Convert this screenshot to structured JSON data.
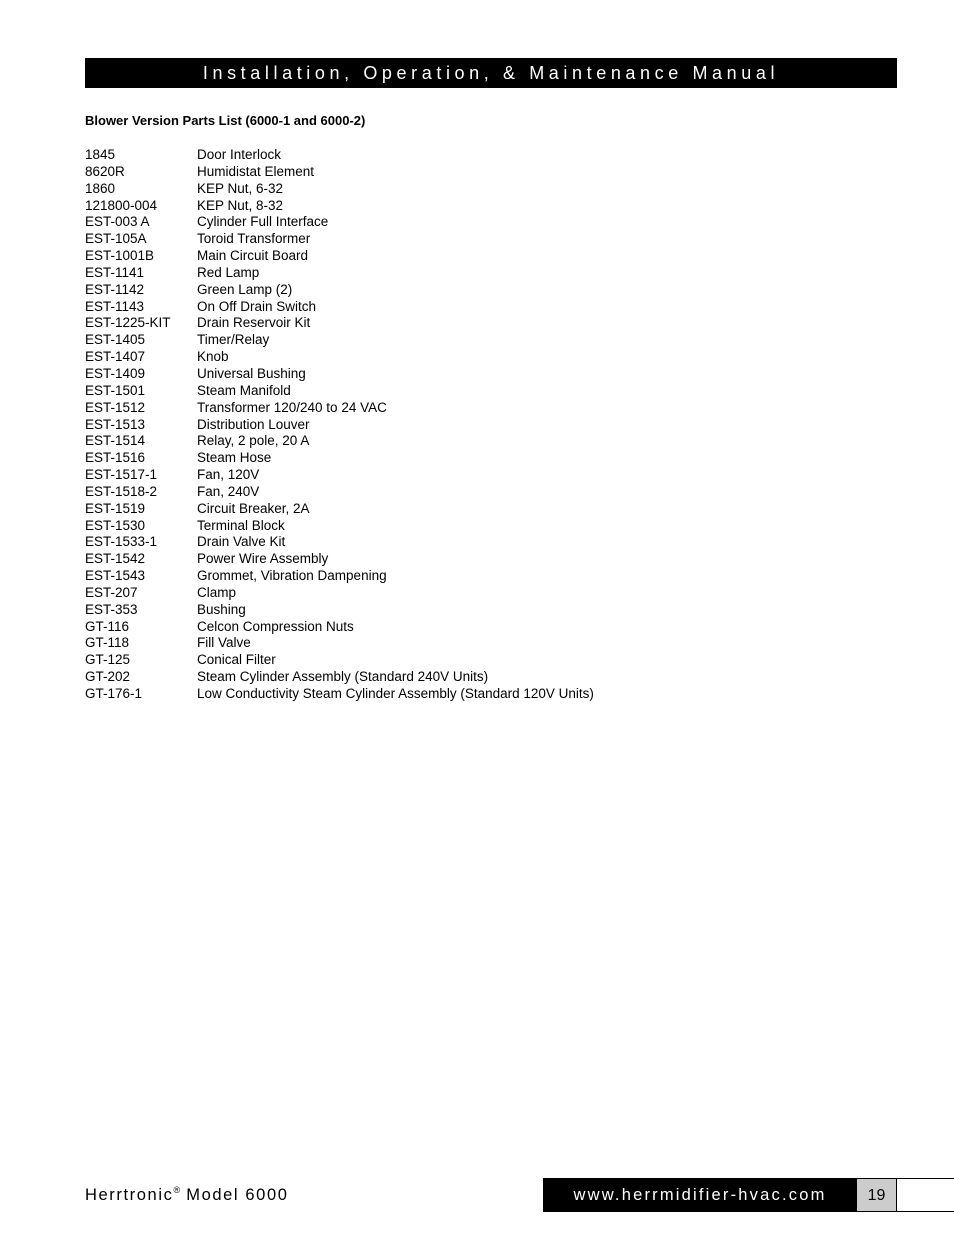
{
  "header": {
    "title": "Installation, Operation, & Maintenance Manual"
  },
  "section": {
    "title": "Blower Version Parts List (6000-1 and 6000-2)"
  },
  "parts": [
    {
      "number": "1845",
      "description": "Door Interlock"
    },
    {
      "number": "8620R",
      "description": "Humidistat Element"
    },
    {
      "number": "1860",
      "description": "KEP Nut, 6-32"
    },
    {
      "number": "121800-004",
      "description": "KEP Nut, 8-32"
    },
    {
      "number": "EST-003 A",
      "description": "Cylinder Full Interface"
    },
    {
      "number": "EST-105A",
      "description": "Toroid Transformer"
    },
    {
      "number": "EST-1001B",
      "description": "Main Circuit Board"
    },
    {
      "number": "EST-1141",
      "description": "Red Lamp"
    },
    {
      "number": "EST-1142",
      "description": "Green Lamp (2)"
    },
    {
      "number": "EST-1143",
      "description": "On Off Drain Switch"
    },
    {
      "number": "EST-1225-KIT",
      "description": "Drain Reservoir Kit"
    },
    {
      "number": "EST-1405",
      "description": "Timer/Relay"
    },
    {
      "number": "EST-1407",
      "description": "Knob"
    },
    {
      "number": "EST-1409",
      "description": "Universal Bushing"
    },
    {
      "number": "EST-1501",
      "description": "Steam Manifold"
    },
    {
      "number": "EST-1512",
      "description": "Transformer 120/240 to 24 VAC"
    },
    {
      "number": "EST-1513",
      "description": "Distribution Louver"
    },
    {
      "number": "EST-1514",
      "description": "Relay, 2 pole, 20 A"
    },
    {
      "number": "EST-1516",
      "description": "Steam Hose"
    },
    {
      "number": "EST-1517-1",
      "description": "Fan, 120V"
    },
    {
      "number": "EST-1518-2",
      "description": "Fan, 240V"
    },
    {
      "number": "EST-1519",
      "description": "Circuit Breaker, 2A"
    },
    {
      "number": "EST-1530",
      "description": "Terminal Block"
    },
    {
      "number": "EST-1533-1",
      "description": "Drain Valve Kit"
    },
    {
      "number": "EST-1542",
      "description": "Power Wire Assembly"
    },
    {
      "number": "EST-1543",
      "description": "Grommet, Vibration Dampening"
    },
    {
      "number": "EST-207",
      "description": "Clamp"
    },
    {
      "number": "EST-353",
      "description": "Bushing"
    },
    {
      "number": "GT-116",
      "description": "Celcon Compression Nuts"
    },
    {
      "number": "GT-118",
      "description": "Fill Valve"
    },
    {
      "number": "GT-125",
      "description": "Conical Filter"
    },
    {
      "number": "GT-202",
      "description": "Steam Cylinder Assembly (Standard 240V Units)"
    },
    {
      "number": "GT-176-1",
      "description": "Low Conductivity Steam Cylinder Assembly (Standard 120V Units)"
    }
  ],
  "footer": {
    "brand": "Herrtronic",
    "registered_mark": "®",
    "model": " Model 6000",
    "url": "www.herrmidifier-hvac.com",
    "page_number": "19"
  }
}
